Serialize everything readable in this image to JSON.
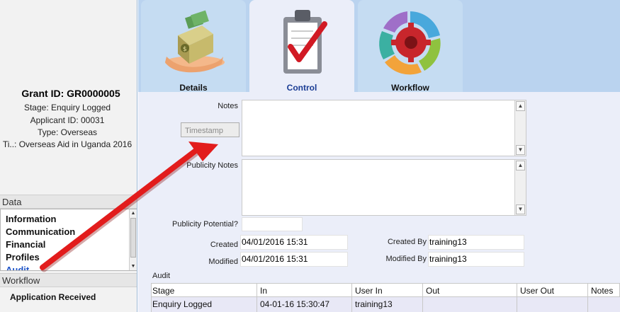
{
  "grant": {
    "title": "Grant ID: GR0000005",
    "stage": "Stage: Enquiry Logged",
    "applicant": "Applicant ID: 00031",
    "type": "Type: Overseas",
    "title_line": "Ti..: Overseas Aid in Uganda 2016"
  },
  "sidebar": {
    "data_header": "Data",
    "data_items": [
      {
        "label": "Information"
      },
      {
        "label": "Communication"
      },
      {
        "label": "Financial"
      },
      {
        "label": "Profiles"
      },
      {
        "label": "Audit"
      }
    ],
    "workflow_header": "Workflow",
    "workflow_items": [
      {
        "label": "Application Received"
      }
    ]
  },
  "tabs": [
    {
      "label": "Details",
      "icon": "money-box-hand-icon"
    },
    {
      "label": "Control",
      "icon": "clipboard-check-icon"
    },
    {
      "label": "Workflow",
      "icon": "cycle-gear-icon"
    }
  ],
  "form": {
    "notes_label": "Notes",
    "timestamp_label": "Timestamp",
    "publicity_notes_label": "Publicity Notes",
    "publicity_potential_label": "Publicity Potential?",
    "publicity_potential_value": "",
    "created_label": "Created",
    "created_value": "04/01/2016 15:31",
    "modified_label": "Modified",
    "modified_value": "04/01/2016 15:31",
    "created_by_label": "Created By",
    "created_by_value": "training13",
    "modified_by_label": "Modified By",
    "modified_by_value": "training13",
    "audit_label": "Audit"
  },
  "audit": {
    "columns": [
      "Stage",
      "In",
      "User In",
      "Out",
      "User Out",
      "Notes"
    ],
    "rows": [
      [
        "Enquiry Logged",
        "04-01-16 15:30:47",
        "training13",
        "",
        "",
        ""
      ]
    ]
  },
  "colors": {
    "tab_bar": "#bad3ef",
    "content_bg": "#ebeef9",
    "active_tab_text": "#1a3c94",
    "link": "#1f55c8",
    "arrow": "#e21c1c"
  }
}
